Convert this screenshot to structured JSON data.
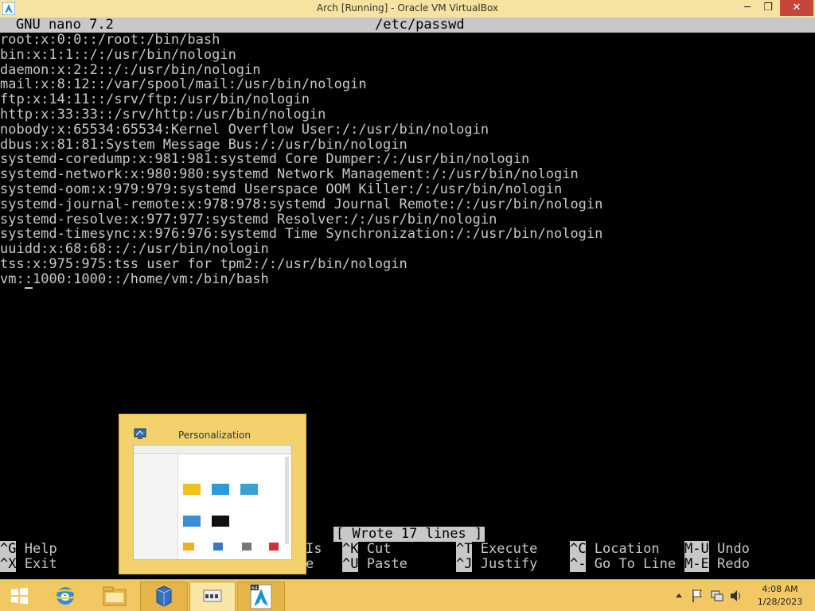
{
  "window": {
    "title": "Arch [Running] - Oracle VM VirtualBox",
    "minimize": "─",
    "maximize": "❐",
    "close": "✕"
  },
  "nano": {
    "version": "GNU nano 7.2",
    "filename": "/etc/passwd",
    "lines": [
      "root:x:0:0::/root:/bin/bash",
      "bin:x:1:1::/:/usr/bin/nologin",
      "daemon:x:2:2::/:/usr/bin/nologin",
      "mail:x:8:12::/var/spool/mail:/usr/bin/nologin",
      "ftp:x:14:11::/srv/ftp:/usr/bin/nologin",
      "http:x:33:33::/srv/http:/usr/bin/nologin",
      "nobody:x:65534:65534:Kernel Overflow User:/:/usr/bin/nologin",
      "dbus:x:81:81:System Message Bus:/:/usr/bin/nologin",
      "systemd-coredump:x:981:981:systemd Core Dumper:/:/usr/bin/nologin",
      "systemd-network:x:980:980:systemd Network Management:/:/usr/bin/nologin",
      "systemd-oom:x:979:979:systemd Userspace OOM Killer:/:/usr/bin/nologin",
      "systemd-journal-remote:x:978:978:systemd Journal Remote:/:/usr/bin/nologin",
      "systemd-resolve:x:977:977:systemd Resolver:/:/usr/bin/nologin",
      "systemd-timesync:x:976:976:systemd Time Synchronization:/:/usr/bin/nologin",
      "uuidd:x:68:68::/:/usr/bin/nologin",
      "tss:x:975:975:tss user for tpm2:/:/usr/bin/nologin"
    ],
    "last_line": {
      "before_cursor": "vm:",
      "cursor_char": ":",
      "after_cursor": "1000:1000::/home/vm:/bin/bash"
    },
    "status": "[ Wrote 17 lines ]",
    "shortcuts": [
      {
        "key": "^G",
        "label": "Help"
      },
      {
        "key": "^X",
        "label": "Exit"
      },
      {
        "key": "^K",
        "label": "Cut"
      },
      {
        "key": "^U",
        "label": "Paste"
      },
      {
        "key": "^T",
        "label": "Execute"
      },
      {
        "key": "^J",
        "label": "Justify"
      },
      {
        "key": "^C",
        "label": "Location"
      },
      {
        "key": "^-",
        "label": "Go To Line"
      },
      {
        "key": "M-U",
        "label": "Undo"
      },
      {
        "key": "M-E",
        "label": "Redo"
      }
    ],
    "hidden_fragments": [
      "Is",
      "e"
    ]
  },
  "thumbnail": {
    "title": "Personalization"
  },
  "taskbar": {
    "items": [
      "start-button",
      "internet-explorer",
      "file-explorer",
      "virtualbox-manager",
      "personalization",
      "arch-vm"
    ],
    "arch_badge": "64",
    "clock_time": "4:08 AM",
    "clock_date": "1/28/2023"
  },
  "colors": {
    "titlebar": "#f6e3a1",
    "taskbar": "#f1c863",
    "terminal_fg": "#c8c8c8",
    "terminal_bg": "#000000"
  }
}
